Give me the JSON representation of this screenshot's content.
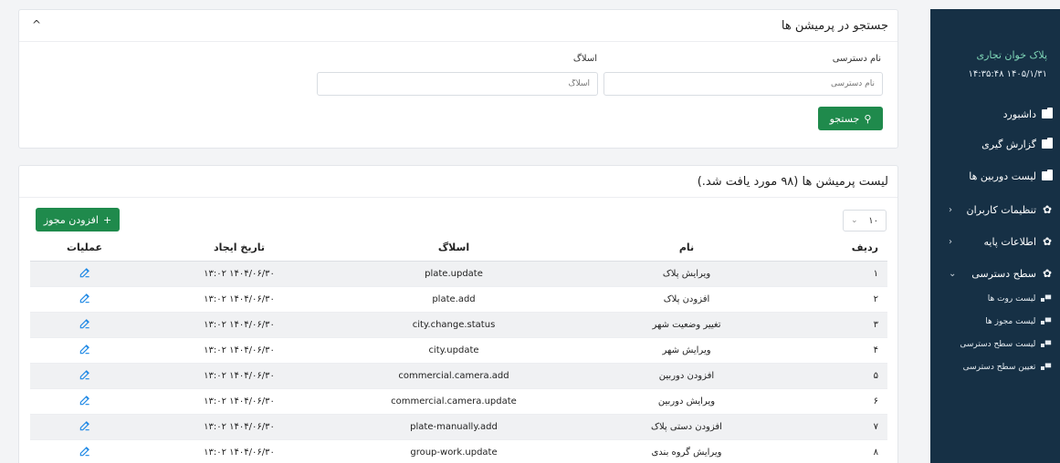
{
  "sidebar": {
    "brand": "پلاک خوان تجاری",
    "clock": "۱۴۰۵/۱/۳۱ ۱۴:۳۵:۴۸",
    "items": [
      {
        "label": "داشبورد",
        "icon": "folder-icon"
      },
      {
        "label": "گزارش گیری",
        "icon": "folder-icon"
      },
      {
        "label": "لیست دوربین ها",
        "icon": "folder-icon"
      },
      {
        "label": "تنظیمات کاربران",
        "icon": "gear-icon",
        "chevron": "‹"
      },
      {
        "label": "اطلاعات پایه",
        "icon": "gear-icon",
        "chevron": "‹"
      },
      {
        "label": "سطح دسترسی",
        "icon": "gear-icon",
        "chevron": "⌄"
      }
    ],
    "subitems": [
      {
        "label": "لیست روت ها"
      },
      {
        "label": "لیست مجوز ها"
      },
      {
        "label": "لیست سطح دسترسی"
      },
      {
        "label": "تعیین سطح دسترسی"
      }
    ]
  },
  "search": {
    "title": "جستجو در پرمیشن ها",
    "collapse": "^",
    "name_label": "نام دسترسی",
    "name_placeholder": "نام دسترسی",
    "slug_label": "اسلاگ",
    "slug_placeholder": "اسلاگ",
    "button": "جستجو"
  },
  "list": {
    "title": "لیست پرمیشن ها (۹۸ مورد یافت شد.)",
    "add_button": "افزودن مجوز",
    "page_size": "۱۰",
    "columns": {
      "index": "ردیف",
      "name": "نام",
      "slug": "اسلاگ",
      "date": "تاریخ ایجاد",
      "ops": "عملیات"
    },
    "rows": [
      {
        "index": "۱",
        "name": "ویرایش پلاک",
        "slug": "plate.update",
        "date": "۱۴۰۴/۰۶/۳۰ ۱۳:۰۲"
      },
      {
        "index": "۲",
        "name": "افزودن پلاک",
        "slug": "plate.add",
        "date": "۱۴۰۴/۰۶/۳۰ ۱۳:۰۲"
      },
      {
        "index": "۳",
        "name": "تغییر وضعیت شهر",
        "slug": "city.change.status",
        "date": "۱۴۰۴/۰۶/۳۰ ۱۳:۰۲"
      },
      {
        "index": "۴",
        "name": "ویرایش شهر",
        "slug": "city.update",
        "date": "۱۴۰۴/۰۶/۳۰ ۱۳:۰۲"
      },
      {
        "index": "۵",
        "name": "افزودن دوربین",
        "slug": "commercial.camera.add",
        "date": "۱۴۰۴/۰۶/۳۰ ۱۳:۰۲"
      },
      {
        "index": "۶",
        "name": "ویرایش دوربین",
        "slug": "commercial.camera.update",
        "date": "۱۴۰۴/۰۶/۳۰ ۱۳:۰۲"
      },
      {
        "index": "۷",
        "name": "افزودن دستی پلاک",
        "slug": "plate-manually.add",
        "date": "۱۴۰۴/۰۶/۳۰ ۱۳:۰۲"
      },
      {
        "index": "۸",
        "name": "ویرایش گروه بندی",
        "slug": "group-work.update",
        "date": "۱۴۰۴/۰۶/۳۰ ۱۳:۰۲"
      }
    ]
  },
  "colors": {
    "sidebar_bg": "#163045",
    "accent_green": "#1f8a4c",
    "edit_blue": "#1e88e5",
    "brand_green": "#7fd6b7"
  }
}
